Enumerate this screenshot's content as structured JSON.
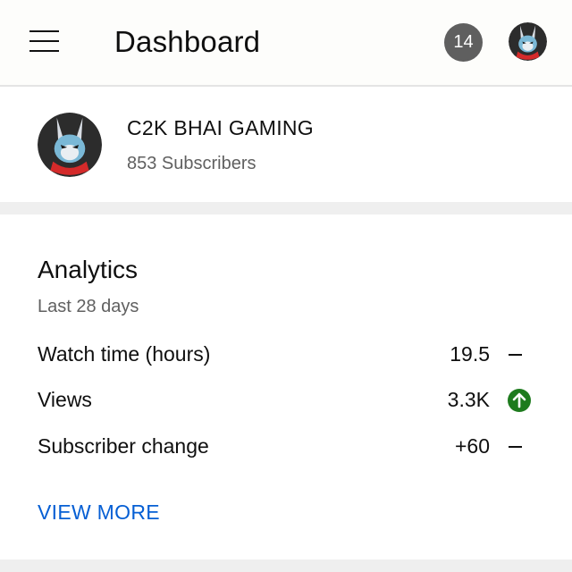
{
  "header": {
    "title": "Dashboard",
    "notification_count": "14",
    "menu_icon": "hamburger-menu-icon",
    "avatar_icon": "bunny-mascot-avatar"
  },
  "channel": {
    "name": "C2K BHAI GAMING",
    "subscribers": "853 Subscribers"
  },
  "analytics": {
    "title": "Analytics",
    "period": "Last 28 days",
    "metrics": [
      {
        "label": "Watch time (hours)",
        "value": "19.5",
        "trend": "flat"
      },
      {
        "label": "Views",
        "value": "3.3K",
        "trend": "up"
      },
      {
        "label": "Subscriber change",
        "value": "+60",
        "trend": "flat"
      }
    ],
    "view_more": "VIEW MORE"
  },
  "colors": {
    "link": "#065fd4",
    "badge": "#5f5f5f",
    "trend_up": "#1e7b1e",
    "separator": "#efefef"
  }
}
